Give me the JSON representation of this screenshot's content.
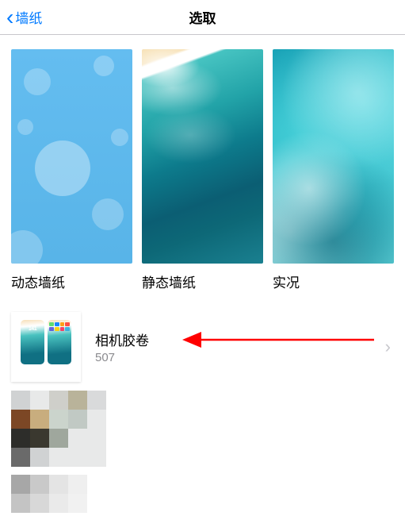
{
  "nav": {
    "back_label": "墙纸",
    "title": "选取"
  },
  "categories": [
    {
      "id": "dynamic",
      "label": "动态墙纸"
    },
    {
      "id": "stills",
      "label": "静态墙纸"
    },
    {
      "id": "live",
      "label": "实况"
    }
  ],
  "album": {
    "name": "相机胶卷",
    "count": "507"
  }
}
